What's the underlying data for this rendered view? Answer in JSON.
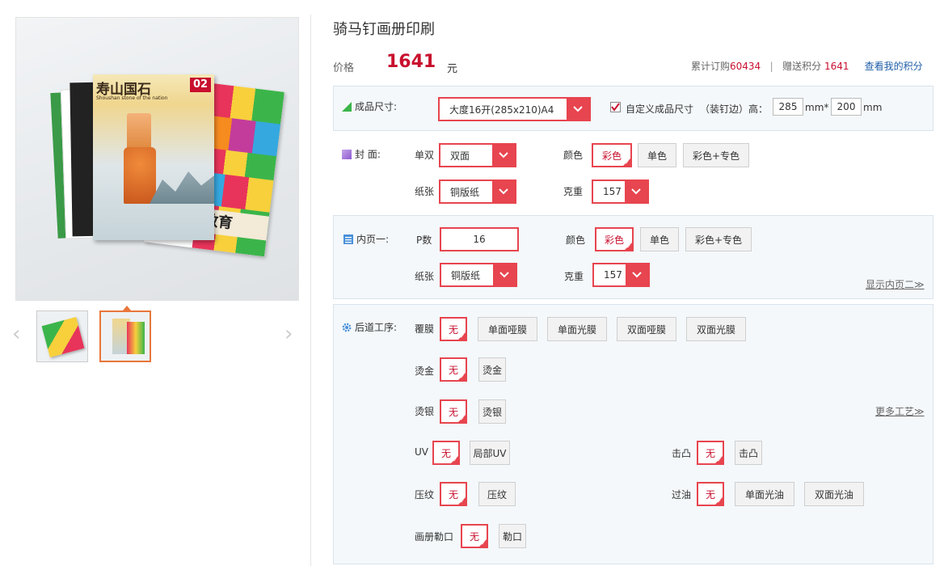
{
  "product": {
    "title": "骑马钉画册印刷",
    "price_label": "价格",
    "price": "1641",
    "currency": "元",
    "orders_label": "累计订购",
    "orders": "60434",
    "points_label": "赠送积分",
    "points": "1641",
    "my_points_link": "查看我的积分",
    "separator": "|"
  },
  "gallery": {
    "cover_title": "寿山国石",
    "cover_issue": "02",
    "cover_subtitle": "Shoushan stone of the nation",
    "back_cover_text": "教育"
  },
  "size": {
    "label": "成品尺寸:",
    "selected": "大度16开(285x210)A4",
    "custom_label": "自定义成品尺寸",
    "custom_checked": true,
    "binding_label": "（装钉边）高：",
    "height": "285",
    "unit_mm_times": "mm*",
    "width": "200",
    "unit_mm": "mm"
  },
  "cover": {
    "label": "封  面:",
    "sides_label": "单双",
    "sides_value": "双面",
    "color_label": "颜色",
    "color_options": [
      "彩色",
      "单色",
      "彩色+专色"
    ],
    "paper_label": "纸张",
    "paper_value": "铜版纸",
    "weight_label": "克重",
    "weight_value": "157"
  },
  "inner": {
    "label": "内页一:",
    "pages_label": "P数",
    "pages_value": "16",
    "color_label": "颜色",
    "color_options": [
      "彩色",
      "单色",
      "彩色+专色"
    ],
    "paper_label": "纸张",
    "paper_value": "铜版纸",
    "weight_label": "克重",
    "weight_value": "157",
    "show_more": "显示内页二≫"
  },
  "finishing": {
    "label": "后道工序:",
    "none": "无",
    "lamination_label": "覆膜",
    "lamination_options": [
      "单面哑膜",
      "单面光膜",
      "双面哑膜",
      "双面光膜"
    ],
    "gold_label": "烫金",
    "gold_option": "烫金",
    "silver_label": "烫银",
    "silver_option": "烫银",
    "uv_label": "UV",
    "uv_option": "局部UV",
    "emboss_label": "击凸",
    "emboss_option": "击凸",
    "texture_label": "压纹",
    "texture_option": "压纹",
    "varnish_label": "过油",
    "varnish_options": [
      "单面光油",
      "双面光油"
    ],
    "crease_label": "画册勒口",
    "crease_option": "勒口",
    "more_link": "更多工艺≫"
  },
  "colors": {
    "accent": "#e7454f",
    "price": "#c8102e",
    "link_blue": "#1f5ea8"
  }
}
